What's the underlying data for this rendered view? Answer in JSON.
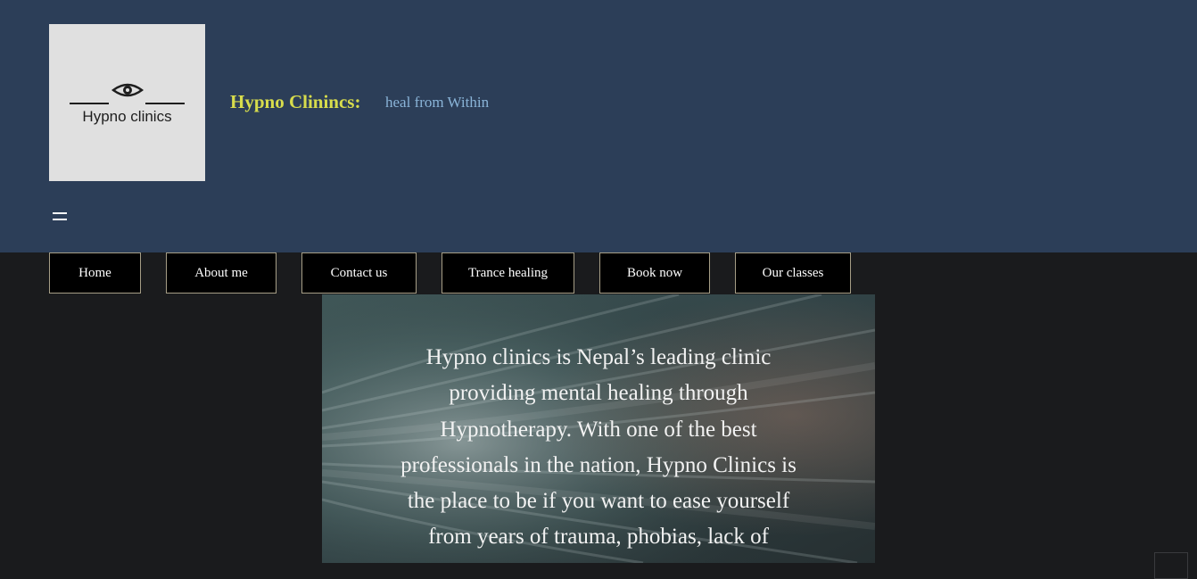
{
  "header": {
    "logo_text": "Hypno clinics",
    "site_title": "Hypno Clinincs:",
    "tagline": "heal from Within",
    "menu_icon": "hamburger-icon"
  },
  "nav": {
    "items": [
      {
        "label": "Home"
      },
      {
        "label": "About me"
      },
      {
        "label": "Contact us"
      },
      {
        "label": "Trance healing"
      },
      {
        "label": "Book now"
      },
      {
        "label": "Our classes"
      }
    ]
  },
  "hero": {
    "text": "Hypno clinics is Nepal’s leading clinic providing mental healing through Hypnotherapy. With one of the best professionals in the nation, Hypno Clinics is the place to be if you want to ease yourself from years of trauma, phobias, lack of"
  },
  "colors": {
    "header_bg": "#2c3e58",
    "page_bg": "#1a1b1d",
    "title": "#d7dc4c",
    "tagline": "#8ab4d8",
    "nav_bg": "#000000",
    "nav_border": "#a69e86"
  }
}
